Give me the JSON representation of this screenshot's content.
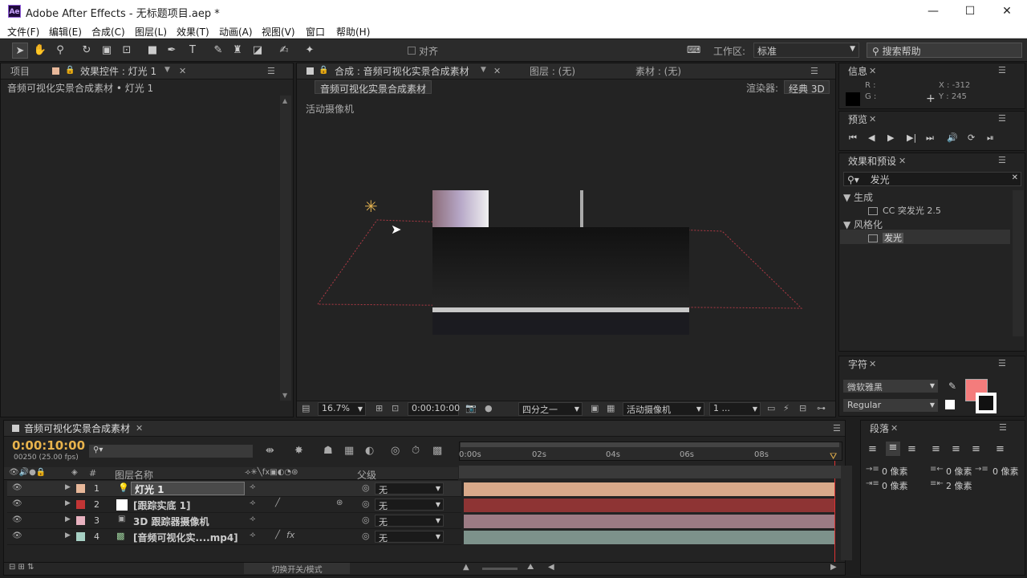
{
  "window": {
    "title": "Adobe After Effects - 无标题项目.aep *",
    "logo": "Ae",
    "min": "—",
    "max": "☐",
    "close": "✕"
  },
  "menu": [
    "文件(F)",
    "编辑(E)",
    "合成(C)",
    "图层(L)",
    "效果(T)",
    "动画(A)",
    "视图(V)",
    "窗口",
    "帮助(H)"
  ],
  "toolbar": {
    "snap_label": "对齐",
    "workspace_label": "工作区:",
    "workspace_value": "标准",
    "search_placeholder": "搜索帮助"
  },
  "project_panel": {
    "tab_project": "项目",
    "tab_effects": "效果控件 : 灯光 1",
    "subtitle": "音频可视化实景合成素材 • 灯光 1"
  },
  "comp_panel": {
    "tab_comp": "合成 : 音频可视化实景合成素材",
    "tab_layer": "图层 : (无)",
    "tab_footage": "素材 : (无)",
    "comp_name_chip": "音频可视化实景合成素材",
    "renderer_label": "渲染器:",
    "renderer_value": "经典 3D",
    "active_camera": "活动摄像机",
    "zoom": "16.7%",
    "timecode": "0:00:10:00",
    "resolution": "四分之一",
    "camera_view": "活动摄像机",
    "views": "1 ..."
  },
  "info_panel": {
    "title": "信息",
    "r_label": "R :",
    "g_label": "G :",
    "x_label": "X : -312",
    "y_label": "Y : 245"
  },
  "preview_panel": {
    "title": "预览"
  },
  "effects_presets": {
    "title": "效果和预设",
    "search_value": "发光",
    "groups": [
      {
        "name": "生成",
        "items": [
          "CC 突发光 2.5"
        ]
      },
      {
        "name": "风格化",
        "items": [
          "发光"
        ]
      }
    ]
  },
  "character_panel": {
    "title": "字符",
    "font": "微软雅黑",
    "style": "Regular",
    "fill_color": "#f47c7c"
  },
  "paragraph_panel": {
    "title": "段落",
    "values": [
      "0 像素",
      "0 像素",
      "0 像素",
      "0 像素",
      "2 像素"
    ]
  },
  "timeline": {
    "tab": "音频可视化实景合成素材",
    "timecode": "0:00:10:00",
    "fps": "00250 (25.00 fps)",
    "search_placeholder": "",
    "col_num": "#",
    "col_name": "图层名称",
    "col_parent": "父级",
    "ruler": [
      "0:00s",
      "02s",
      "04s",
      "06s",
      "08s"
    ],
    "footer": "切换开关/模式",
    "layers": [
      {
        "num": "1",
        "name": "灯光 1",
        "color": "#e8b89a",
        "parent": "无",
        "bar": "#d9a98a",
        "selected": true
      },
      {
        "num": "2",
        "name": "[跟踪实底 1]",
        "color": "#c23535",
        "parent": "无",
        "bar": "#8e3434",
        "selected": false
      },
      {
        "num": "3",
        "name": "3D 跟踪器摄像机",
        "color": "#e8b2c0",
        "parent": "无",
        "bar": "#9c7b84",
        "selected": false
      },
      {
        "num": "4",
        "name": "[音频可视化实....mp4]",
        "color": "#a7d0c4",
        "parent": "无",
        "bar": "#7d928b",
        "selected": false
      }
    ]
  }
}
